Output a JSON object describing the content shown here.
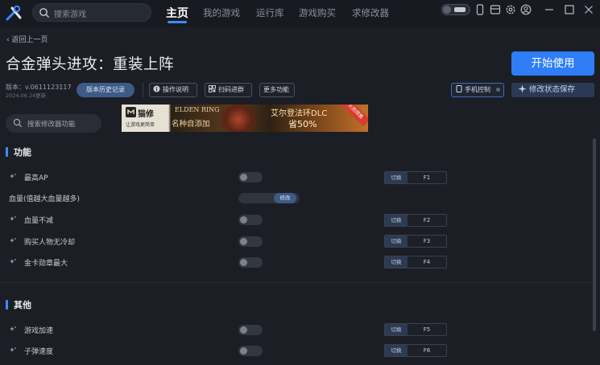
{
  "topbar": {
    "search_placeholder": "搜索游戏",
    "nav": [
      "主页",
      "我的游戏",
      "运行库",
      "游戏购买",
      "求修改器"
    ],
    "active_nav": "主页"
  },
  "header": {
    "back_label": "返回上一页",
    "game_title": "合金弹头进攻：重装上阵",
    "start_button": "开始使用",
    "version": "版本：v.0611123117",
    "version_date": "2024.06.24更新",
    "history_button": "版本历史记录",
    "tool_buttons": [
      "操作说明",
      "扫码进群",
      "更多功能"
    ],
    "phone_control": "手机控制",
    "save_state": "修改状态保存"
  },
  "feature_search": {
    "placeholder": "搜索修改器功能"
  },
  "banner": {
    "brand": "猫修",
    "slogan": "让游戏更简单",
    "line1": "ELDEN RING",
    "line2": "名种自添加",
    "line3": "艾尔登法环DLC",
    "line4": "省50%",
    "tag": "火热预售"
  },
  "sections": [
    {
      "title": "功能",
      "rows": [
        {
          "label": "最高AP",
          "control": "toggle",
          "hotkey_action": "切换",
          "hotkey": "F1"
        },
        {
          "label": "血量(值越大血量越多)",
          "control": "slider",
          "slider_label": "修改"
        },
        {
          "label": "血量不减",
          "control": "toggle",
          "hotkey_action": "切换",
          "hotkey": "F2"
        },
        {
          "label": "购买人物无冷却",
          "control": "toggle",
          "hotkey_action": "切换",
          "hotkey": "F3"
        },
        {
          "label": "金卡勋章最大",
          "control": "toggle",
          "hotkey_action": "切换",
          "hotkey": "F4"
        }
      ]
    },
    {
      "title": "其他",
      "rows": [
        {
          "label": "游戏加速",
          "control": "toggle",
          "hotkey_action": "切换",
          "hotkey": "F5"
        },
        {
          "label": "子弹速度",
          "control": "toggle",
          "hotkey_action": "切换",
          "hotkey": "F6"
        }
      ]
    }
  ],
  "colors": {
    "accent": "#2f7df7",
    "background": "#1b1e25",
    "titlebar": "#171a20"
  }
}
